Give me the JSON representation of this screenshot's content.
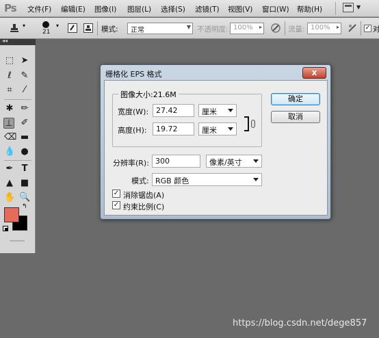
{
  "app": {
    "logo": "Ps"
  },
  "menu": {
    "items": [
      "文件(F)",
      "编辑(E)",
      "图像(I)",
      "图层(L)",
      "选择(S)",
      "滤镜(T)",
      "视图(V)",
      "窗口(W)",
      "帮助(H)"
    ]
  },
  "options": {
    "brush_size": "21",
    "mode_label": "模式:",
    "mode_value": "正常",
    "opacity_label": "不透明度:",
    "opacity_value": "100%",
    "flow_label": "流量:",
    "flow_value": "100%",
    "align_label": "对"
  },
  "colors": {
    "foreground": "#e56b5a",
    "background": "#000000"
  },
  "dialog": {
    "title": "栅格化 EPS 格式",
    "close_label": "x",
    "image_size_label": "图像大小:21.6M",
    "width_label": "宽度(W):",
    "width_value": "27.42",
    "width_unit": "厘米",
    "height_label": "高度(H):",
    "height_value": "19.72",
    "height_unit": "厘米",
    "resolution_label": "分辨率(R):",
    "resolution_value": "300",
    "resolution_unit": "像素/英寸",
    "mode_label": "模式:",
    "mode_value": "RGB 颜色",
    "antialias_label": "消除锯齿(A)",
    "antialias_checked": true,
    "constrain_label": "约束比例(C)",
    "constrain_checked": true,
    "ok_label": "确定",
    "cancel_label": "取消"
  },
  "watermark": "https://blog.csdn.net/dege857"
}
